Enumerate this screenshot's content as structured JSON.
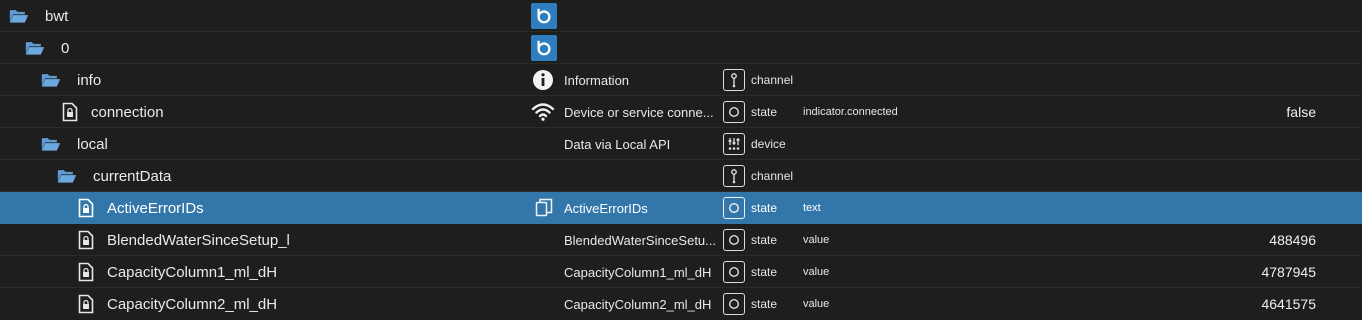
{
  "rows": [
    {
      "name": "bwt",
      "desc": "",
      "type": "",
      "role": "",
      "value": ""
    },
    {
      "name": "0",
      "desc": "",
      "type": "",
      "role": "",
      "value": ""
    },
    {
      "name": "info",
      "desc": "Information",
      "type": "channel",
      "role": "",
      "value": ""
    },
    {
      "name": "connection",
      "desc": "Device or service conne...",
      "type": "state",
      "role": "indicator.connected",
      "value": "false"
    },
    {
      "name": "local",
      "desc": "Data via Local API",
      "type": "device",
      "role": "",
      "value": ""
    },
    {
      "name": "currentData",
      "desc": "",
      "type": "channel",
      "role": "",
      "value": ""
    },
    {
      "name": "ActiveErrorIDs",
      "desc": "ActiveErrorIDs",
      "type": "state",
      "role": "text",
      "value": ""
    },
    {
      "name": "BlendedWaterSinceSetup_l",
      "desc": "BlendedWaterSinceSetu...",
      "type": "state",
      "role": "value",
      "value": "488496"
    },
    {
      "name": "CapacityColumn1_ml_dH",
      "desc": "CapacityColumn1_ml_dH",
      "type": "state",
      "role": "value",
      "value": "4787945"
    },
    {
      "name": "CapacityColumn2_ml_dH",
      "desc": "CapacityColumn2_ml_dH",
      "type": "state",
      "role": "value",
      "value": "4641575"
    }
  ],
  "selected_row": "ActiveErrorIDs",
  "colors": {
    "selection": "#3377aa",
    "folder": "#5b9bd5",
    "logo_bg": "#2f7fc0",
    "background": "#1e1e1e"
  },
  "icons": {
    "folder": "folder-open-icon",
    "state": "state-file-icon",
    "adapter_logo": "bwt-adapter-logo-icon",
    "info": "info-circle-icon",
    "wifi": "wifi-icon",
    "copy": "copy-icon",
    "channel": "channel-type-icon",
    "state_type": "state-type-icon",
    "device": "device-type-icon"
  }
}
